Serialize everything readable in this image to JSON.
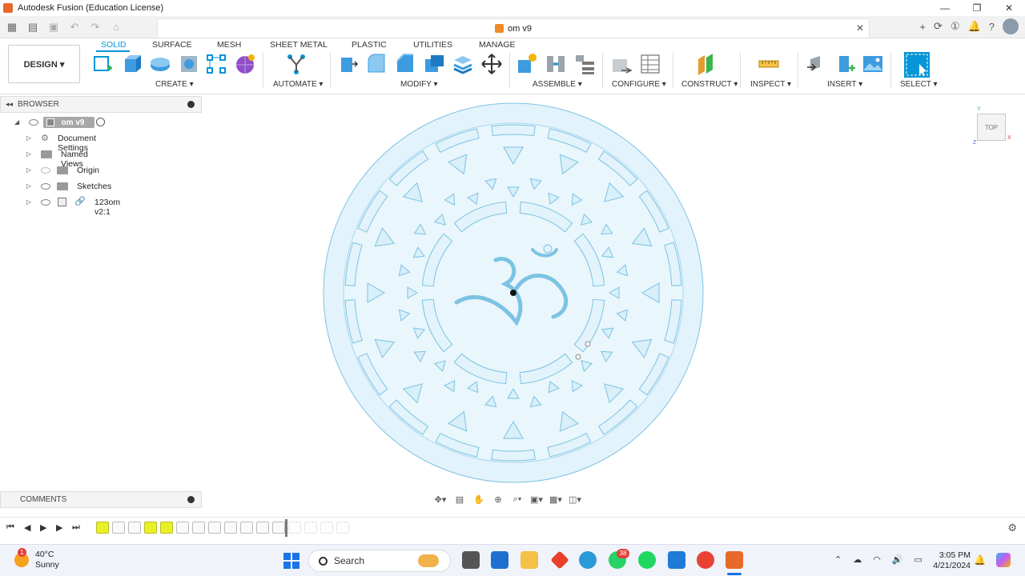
{
  "window": {
    "title": "Autodesk Fusion (Education License)",
    "controls": [
      "—",
      "❐",
      "✕"
    ]
  },
  "doc_tab": {
    "name": "om v9",
    "close": "✕"
  },
  "workspace": {
    "mode": "DESIGN ▾"
  },
  "ws_tabs": [
    "SOLID",
    "SURFACE",
    "MESH",
    "SHEET METAL",
    "PLASTIC",
    "UTILITIES",
    "MANAGE"
  ],
  "groups": {
    "create": "CREATE ▾",
    "automate": "AUTOMATE ▾",
    "modify": "MODIFY ▾",
    "assemble": "ASSEMBLE ▾",
    "configure": "CONFIGURE ▾",
    "construct": "CONSTRUCT ▾",
    "inspect": "INSPECT ▾",
    "insert": "INSERT ▾",
    "select": "SELECT ▾"
  },
  "browser": {
    "title": "BROWSER",
    "root": "om v9",
    "items": [
      {
        "label": "Document Settings"
      },
      {
        "label": "Named Views"
      },
      {
        "label": "Origin"
      },
      {
        "label": "Sketches"
      },
      {
        "label": "123om v2:1"
      }
    ]
  },
  "comments": {
    "title": "COMMENTS"
  },
  "viewcube": {
    "label": "TOP",
    "axis_y": "Y",
    "axis_x": "X",
    "axis_z": "Z"
  },
  "taskbar": {
    "weather_temp": "40°C",
    "weather_desc": "Sunny",
    "weather_badge": "1",
    "search_label": "Search",
    "whatsapp_badge": "38",
    "time": "3:05 PM",
    "date": "4/21/2024"
  },
  "colors": {
    "accent": "#0696d7",
    "sketch_fill": "#e3f3fb",
    "sketch_stroke": "#7cc3e3"
  }
}
